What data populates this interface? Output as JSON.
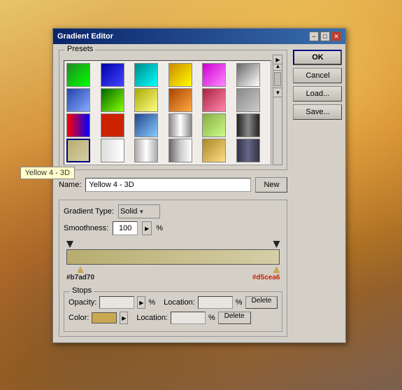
{
  "window": {
    "title": "Gradient Editor",
    "minimize_label": "−",
    "maximize_label": "□",
    "close_label": "✕"
  },
  "presets": {
    "group_label": "Presets",
    "right_arrow": "▶",
    "tooltip": "Yellow 4 - 3D",
    "items": [
      {
        "id": "p1"
      },
      {
        "id": "p2"
      },
      {
        "id": "p3"
      },
      {
        "id": "p4"
      },
      {
        "id": "p5"
      },
      {
        "id": "p6"
      },
      {
        "id": "p7"
      },
      {
        "id": "p8"
      },
      {
        "id": "p9"
      },
      {
        "id": "p10"
      },
      {
        "id": "p11"
      },
      {
        "id": "p12"
      },
      {
        "id": "p13"
      },
      {
        "id": "p14"
      },
      {
        "id": "p15"
      },
      {
        "id": "p16"
      },
      {
        "id": "p17"
      },
      {
        "id": "p18"
      },
      {
        "id": "p19",
        "selected": true
      },
      {
        "id": "p20"
      },
      {
        "id": "p21"
      },
      {
        "id": "p22"
      },
      {
        "id": "p23"
      },
      {
        "id": "p24"
      }
    ]
  },
  "name_row": {
    "label": "Name:",
    "value": "Yellow 4 - 3D",
    "new_btn": "New"
  },
  "gradient_settings": {
    "type_label": "Gradient Type:",
    "type_value": "Solid",
    "smoothness_label": "Smoothness:",
    "smoothness_value": "100",
    "pct": "%"
  },
  "gradient_bar": {
    "left_color": "#b7ad70",
    "right_color": "#d5cea6",
    "left_label": "#b7ad70",
    "right_label": "#d5cea6"
  },
  "stops": {
    "group_label": "Stops",
    "opacity_label": "Opacity:",
    "opacity_pct": "%",
    "location_label1": "Location:",
    "location_pct1": "%",
    "delete_btn1": "Delete",
    "color_label": "Color:",
    "location_label2": "Location:",
    "location_pct2": "%",
    "delete_btn2": "Delete"
  },
  "buttons": {
    "ok": "OK",
    "cancel": "Cancel",
    "load": "Load...",
    "save": "Save..."
  }
}
